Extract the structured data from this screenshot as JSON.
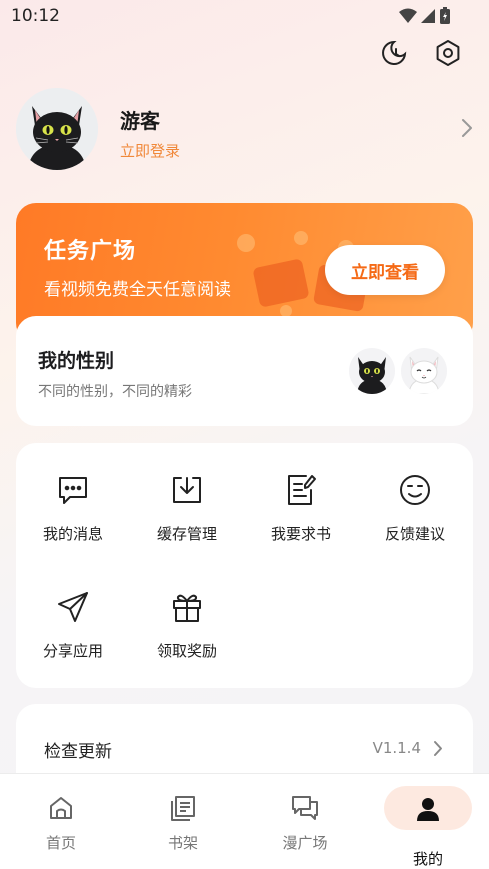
{
  "status_bar": {
    "time": "10:12"
  },
  "top_actions": {
    "night_mode_icon": "moon-clock-icon",
    "settings_icon": "hexagon-gear-icon"
  },
  "profile": {
    "name": "游客",
    "login_text": "立即登录"
  },
  "task_banner": {
    "title": "任务广场",
    "subtitle": "看视频免费全天任意阅读",
    "button_label": "立即查看"
  },
  "gender": {
    "title": "我的性别",
    "subtitle": "不同的性别，不同的精彩"
  },
  "menu": {
    "items": [
      {
        "label": "我的消息",
        "icon": "message-icon"
      },
      {
        "label": "缓存管理",
        "icon": "download-icon"
      },
      {
        "label": "我要求书",
        "icon": "request-book-icon"
      },
      {
        "label": "反馈建议",
        "icon": "feedback-icon"
      },
      {
        "label": "分享应用",
        "icon": "share-icon"
      },
      {
        "label": "领取奖励",
        "icon": "gift-icon"
      }
    ]
  },
  "update": {
    "title": "检查更新",
    "version": "V1.1.4"
  },
  "tabbar": {
    "tabs": [
      {
        "label": "首页",
        "icon": "home-icon"
      },
      {
        "label": "书架",
        "icon": "bookshelf-icon"
      },
      {
        "label": "漫广场",
        "icon": "forum-icon"
      },
      {
        "label": "我的",
        "icon": "person-icon",
        "active": true
      }
    ]
  },
  "colors": {
    "accent": "#f0883a",
    "banner": "#ff7a26",
    "button_text": "#f56a16"
  }
}
